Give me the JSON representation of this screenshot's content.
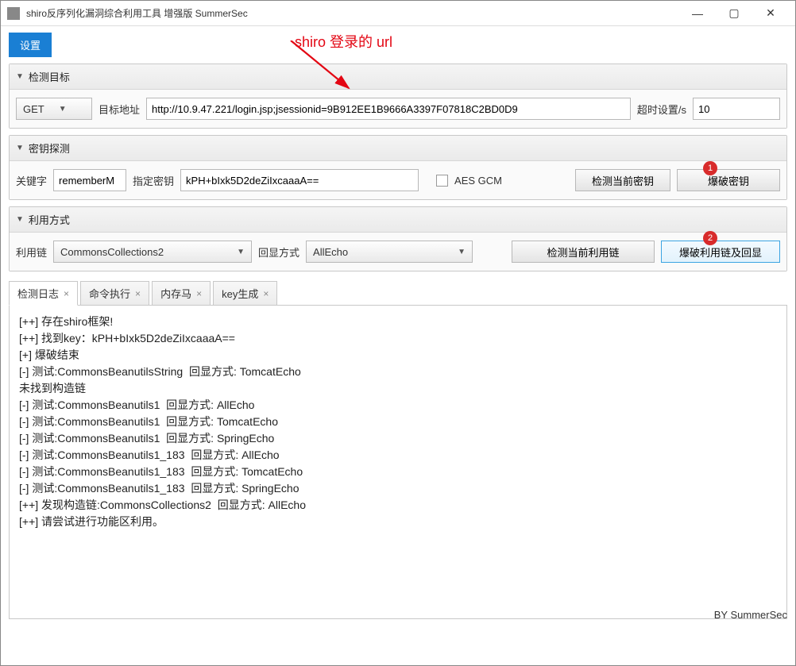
{
  "window": {
    "title": "shiro反序列化漏洞综合利用工具 增强版 SummerSec"
  },
  "toolbar": {
    "settings": "设置"
  },
  "annotation": {
    "text": "shiro 登录的 url",
    "badge1": "1",
    "badge2": "2"
  },
  "panels": {
    "target": {
      "title": "检测目标",
      "method": "GET",
      "url_label": "目标地址",
      "url": "http://10.9.47.221/login.jsp;jsessionid=9B912EE1B9666A3397F07818C2BD0D9",
      "timeout_label": "超时设置/s",
      "timeout": "10"
    },
    "key": {
      "title": "密钥探测",
      "keyword_label": "关键字",
      "keyword": "rememberM",
      "specify_label": "指定密钥",
      "key_value": "kPH+bIxk5D2deZiIxcaaaA==",
      "aes_gcm": "AES GCM",
      "detect_btn": "检测当前密钥",
      "brute_btn": "爆破密钥"
    },
    "exploit": {
      "title": "利用方式",
      "chain_label": "利用链",
      "chain_value": "CommonsCollections2",
      "echo_label": "回显方式",
      "echo_value": "AllEcho",
      "detect_btn": "检测当前利用链",
      "brute_btn": "爆破利用链及回显"
    }
  },
  "tabs": [
    {
      "label": "检测日志"
    },
    {
      "label": "命令执行"
    },
    {
      "label": "内存马"
    },
    {
      "label": "key生成"
    }
  ],
  "log_lines": [
    "[++] 存在shiro框架!",
    "[++] 找到key：kPH+bIxk5D2deZiIxcaaaA==",
    "[+] 爆破结束",
    "[-] 测试:CommonsBeanutilsString  回显方式: TomcatEcho",
    "未找到构造链",
    "[-] 测试:CommonsBeanutils1  回显方式: AllEcho",
    "[-] 测试:CommonsBeanutils1  回显方式: TomcatEcho",
    "[-] 测试:CommonsBeanutils1  回显方式: SpringEcho",
    "[-] 测试:CommonsBeanutils1_183  回显方式: AllEcho",
    "[-] 测试:CommonsBeanutils1_183  回显方式: TomcatEcho",
    "[-] 测试:CommonsBeanutils1_183  回显方式: SpringEcho",
    "[++] 发现构造链:CommonsCollections2  回显方式: AllEcho",
    "[++] 请尝试进行功能区利用。"
  ],
  "footer": "BY   SummerSec"
}
